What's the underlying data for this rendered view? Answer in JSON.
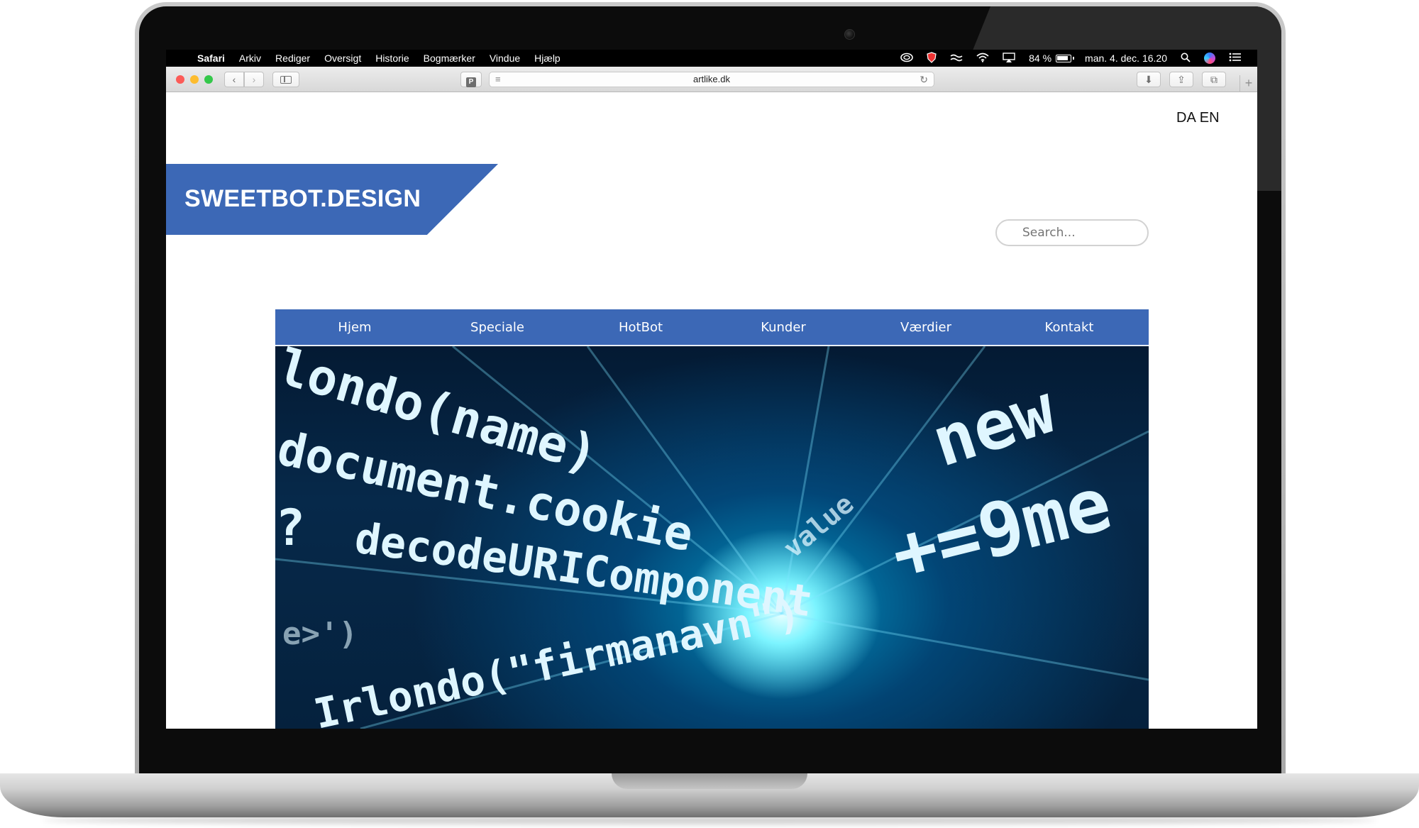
{
  "menubar": {
    "app_name": "Safari",
    "items": [
      "Arkiv",
      "Rediger",
      "Oversigt",
      "Historie",
      "Bogmærker",
      "Vindue",
      "Hjælp"
    ],
    "battery": "84 %",
    "datetime": "man. 4. dec. 16.20"
  },
  "browser": {
    "url": "artlike.dk",
    "back_glyph": "‹",
    "forward_glyph": "›",
    "pocket_glyph": "P",
    "reader_glyph": "≡",
    "reload_glyph": "↻",
    "download_glyph": "⬇",
    "share_glyph": "⇪",
    "tabs_glyph": "⧉",
    "newtab_glyph": "+"
  },
  "site": {
    "logo": "SWEETBOT.DESIGN",
    "languages": [
      "DA",
      "EN"
    ],
    "search_placeholder": "Search...",
    "nav": [
      "Hjem",
      "Speciale",
      "HotBot",
      "Kunder",
      "Værdier",
      "Kontakt"
    ],
    "hero_code": [
      "londo(name)",
      "document.cookie",
      "decodeURIComponent",
      "?",
      "e>')",
      "Irlondo(\"firmanavn\")",
      "new",
      "+=9me",
      "value"
    ],
    "brand_color": "#3c68b6"
  }
}
